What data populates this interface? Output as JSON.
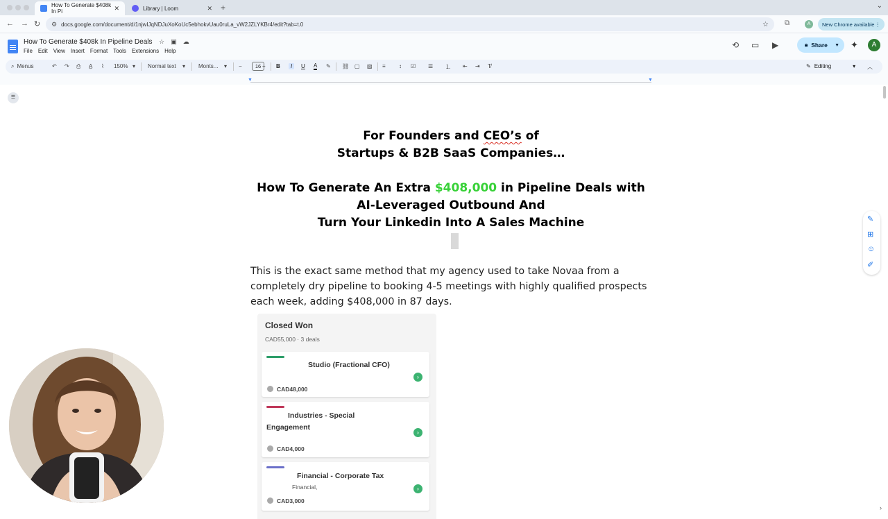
{
  "browser": {
    "tabs": [
      {
        "title": "How To Generate $408k In Pi",
        "active": true
      },
      {
        "title": "Library | Loom",
        "active": false
      }
    ],
    "url": "docs.google.com/document/d/1njwIJqNDJuXoKoUc5ebhokvUau0ruLa_vW2JZLYKBr4/edit?tab=t.0",
    "new_chrome_label": "New Chrome available",
    "profile_initial": "A"
  },
  "docs": {
    "title": "How To Generate $408k In Pipeline Deals",
    "menu": [
      "File",
      "Edit",
      "View",
      "Insert",
      "Format",
      "Tools",
      "Extensions",
      "Help"
    ],
    "share_label": "Share",
    "avatar_initial": "A",
    "toolbar": {
      "menus_label": "Menus",
      "zoom": "150%",
      "style": "Normal text",
      "font": "Monts...",
      "font_size": "16",
      "mode": "Editing"
    }
  },
  "content": {
    "heading_line1_pre": "For Founders and ",
    "heading_line1_mid": "CEO’s",
    "heading_line1_post": " of",
    "heading_line2": "Startups & B2B SaaS Companies…",
    "headline_pre": "How To Generate An Extra ",
    "headline_amount": "$408,000",
    "headline_post": " in Pipeline Deals with",
    "headline_line2": "AI-Leveraged Outbound And",
    "headline_line3": "Turn Your Linkedin Into A Sales Machine",
    "body": "This is the exact same method that my agency used to take Novaa from a completely dry pipeline to booking 4-5 meetings with highly qualified prospects each week, adding $408,000 in 87 days."
  },
  "crm": {
    "column_title": "Closed Won",
    "summary": "CAD55,000 · 3 deals",
    "deals": [
      {
        "name": "Studio (Fractional CFO)",
        "sub": "",
        "amount": "CAD48,000",
        "color": "#2e9e6a"
      },
      {
        "name": "Industries - Special Engagement",
        "sub": "",
        "amount": "CAD4,000",
        "color": "#c0395a"
      },
      {
        "name": "Financial - Corporate Tax",
        "sub": "Financial,",
        "amount": "CAD3,000",
        "color": "#6b70c9"
      }
    ]
  },
  "colors": {
    "accent_green": "#38d138",
    "share_blue": "#c2e7ff",
    "docs_blue": "#4285f4"
  }
}
